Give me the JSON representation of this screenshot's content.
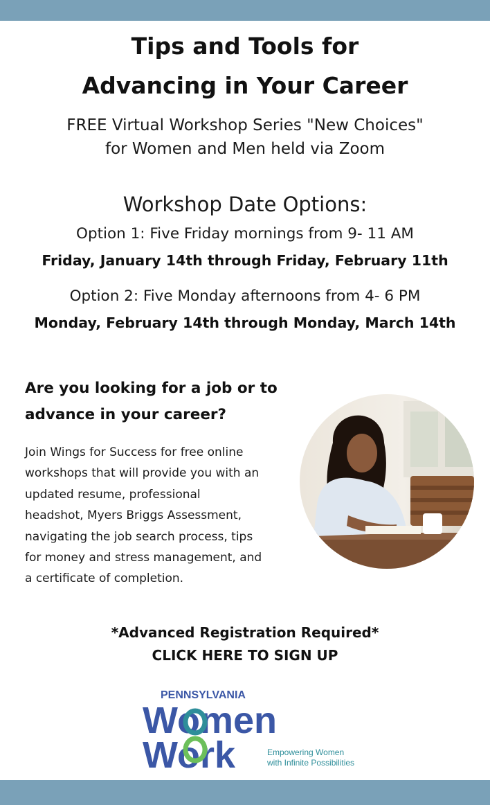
{
  "flyer": {
    "title_line1": "Tips and Tools for",
    "title_line2": "Advancing in Your Career",
    "subtitle_line1": "FREE Virtual Workshop Series \"New Choices\"",
    "subtitle_line2": "for Women and Men held via Zoom",
    "dates_heading": "Workshop Date Options:",
    "option1": "Option 1: Five Friday mornings from 9- 11 AM",
    "option1_dates": "Friday, January 14th through Friday, February 11th",
    "option2": "Option 2: Five Monday afternoons from 4- 6 PM",
    "option2_dates": "Monday, February 14th through Monday, March 14th",
    "question_line1": "Are you looking for a job or to",
    "question_line2": "advance in your career?",
    "body_lines": [
      "Join Wings for Success for free online",
      "workshops that will provide you with an",
      "updated resume, professional",
      "headshot, Myers Briggs Assessment,",
      "navigating the job search process, tips",
      "for money and stress management, and",
      "a certificate of completion."
    ],
    "registration_note": "*Advanced Registration Required*",
    "signup_link": "CLICK HERE TO SIGN UP"
  },
  "logo": {
    "state": "PENNSYLVANIA",
    "word1": "Women",
    "word2": "Work",
    "tagline_line1": "Empowering Women",
    "tagline_line2": "with Infinite Possibilities"
  },
  "colors": {
    "bar": "#7aa1b8",
    "logo_navy": "#3b57a6",
    "logo_teal": "#2e8e9a",
    "logo_green": "#6cbf5a"
  }
}
